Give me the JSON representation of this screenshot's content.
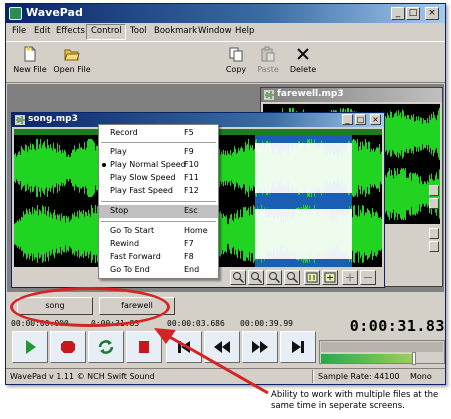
{
  "window": {
    "title": "WavePad",
    "title_icon": "wavepad-logo-icon"
  },
  "menu": [
    "File",
    "Edit",
    "Effects",
    "Control",
    "Tool",
    "Bookmark",
    "Window",
    "Help"
  ],
  "toolbar": {
    "new_file": "New File",
    "open_file": "Open File",
    "copy": "Copy",
    "paste": "Paste",
    "delete": "Delete"
  },
  "control_menu": [
    {
      "label": "Record",
      "shortcut": "F5"
    },
    {
      "label": "Play",
      "shortcut": "F9"
    },
    {
      "label": "Play Normal Speed",
      "shortcut": "F10",
      "checked": true
    },
    {
      "label": "Play Slow Speed",
      "shortcut": "F11"
    },
    {
      "label": "Play Fast Speed",
      "shortcut": "F12"
    },
    {
      "label": "Stop",
      "shortcut": "Esc",
      "highlighted": true
    },
    {
      "label": "Go To Start",
      "shortcut": "Home"
    },
    {
      "label": "Rewind",
      "shortcut": "F7"
    },
    {
      "label": "Fast Forward",
      "shortcut": "F8"
    },
    {
      "label": "Go To End",
      "shortcut": "End"
    }
  ],
  "windows": {
    "song": {
      "title": "song.mp3"
    },
    "farewell": {
      "title": "farewell.mp3"
    }
  },
  "file_tabs": [
    "song",
    "farewell"
  ],
  "times": {
    "t1": "00:00:00.000",
    "t2": "0:00:31.83",
    "t3": "00:00:03.686",
    "t4": "00:00:39.99",
    "big": "0:00:31.83"
  },
  "level_fraction": 0.78,
  "status": {
    "version": "WavePad v 1.11 © NCH Swift Sound",
    "sample_rate": "Sample Rate: 44100",
    "mode": "Mono"
  },
  "annotation": "Ability to work with multiple files at the same time in seperate screens.",
  "colors": {
    "wave_green": "#21d421",
    "selection_blue": "#1a5fb4",
    "annotation_red": "#d42424"
  }
}
